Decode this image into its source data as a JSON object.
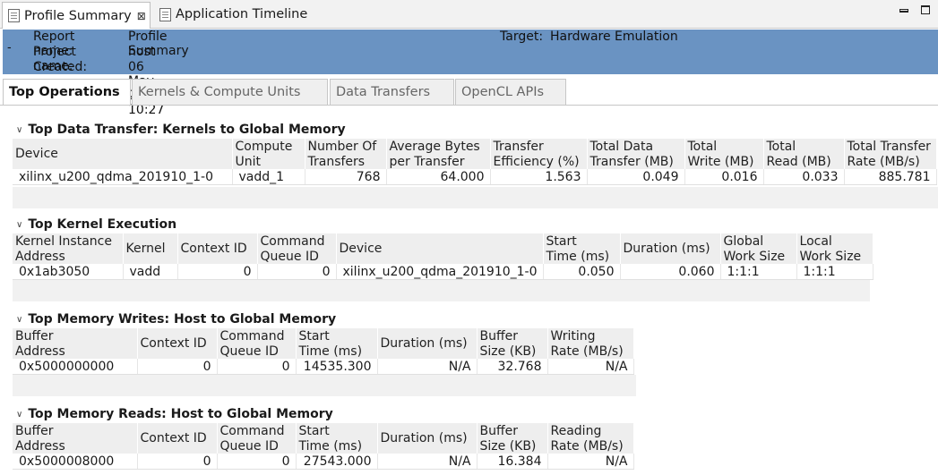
{
  "editor_tabs": [
    {
      "label": "Profile Summary",
      "icon": "profile-summary-icon",
      "active": true
    },
    {
      "label": "Application Timeline",
      "icon": "timeline-icon",
      "active": false
    }
  ],
  "window_controls": {
    "minimize_icon": "minimize-icon",
    "maximize_icon": "maximize-icon",
    "close_icon": "close-icon"
  },
  "report": {
    "collapse_symbol": "-",
    "report_name_label": "Report name:",
    "report_name": "Profile Summary",
    "project_name_label": "Project name:",
    "project_name": "host",
    "created_label": "Created:",
    "created": "06 May 2019 10:27",
    "target_label": "Target:",
    "target": "Hardware Emulation",
    "background_color": "#6a93c2"
  },
  "report_tabs": [
    "Top Operations",
    "Kernels & Compute Units",
    "Data Transfers",
    "OpenCL APIs"
  ],
  "sections": {
    "data_transfer": {
      "title": "Top Data Transfer: Kernels to Global Memory",
      "headers": [
        "Device",
        "Compute\nUnit",
        "Number Of\nTransfers",
        "Average Bytes\nper Transfer",
        "Transfer\nEfficiency (%)",
        "Total Data\nTransfer (MB)",
        "Total\nWrite (MB)",
        "Total\nRead (MB)",
        "Total Transfer\nRate (MB/s)"
      ],
      "row": [
        "xilinx_u200_qdma_201910_1-0",
        "vadd_1",
        "768",
        "64.000",
        "1.563",
        "0.049",
        "0.016",
        "0.033",
        "885.781"
      ]
    },
    "kernel_execution": {
      "title": "Top Kernel Execution",
      "headers": [
        "Kernel Instance\nAddress",
        "Kernel",
        "Context ID",
        "Command\nQueue ID",
        "Device",
        "Start\nTime (ms)",
        "Duration (ms)",
        "Global\nWork Size",
        "Local\nWork Size"
      ],
      "row": [
        "0x1ab3050",
        "vadd",
        "0",
        "0",
        "xilinx_u200_qdma_201910_1-0",
        "0.050",
        "0.060",
        "1:1:1",
        "1:1:1"
      ]
    },
    "memory_writes": {
      "title": "Top Memory Writes: Host to Global Memory",
      "headers": [
        "Buffer\nAddress",
        "Context ID",
        "Command\nQueue ID",
        "Start\nTime (ms)",
        "Duration (ms)",
        "Buffer\nSize (KB)",
        "Writing\nRate (MB/s)"
      ],
      "row": [
        "0x5000000000",
        "0",
        "0",
        "14535.300",
        "N/A",
        "32.768",
        "N/A"
      ]
    },
    "memory_reads": {
      "title": "Top Memory Reads: Host to Global Memory",
      "headers": [
        "Buffer\nAddress",
        "Context ID",
        "Command\nQueue ID",
        "Start\nTime (ms)",
        "Duration (ms)",
        "Buffer\nSize (KB)",
        "Reading\nRate (MB/s)"
      ],
      "row": [
        "0x5000008000",
        "0",
        "0",
        "27543.000",
        "N/A",
        "16.384",
        "N/A"
      ]
    }
  }
}
